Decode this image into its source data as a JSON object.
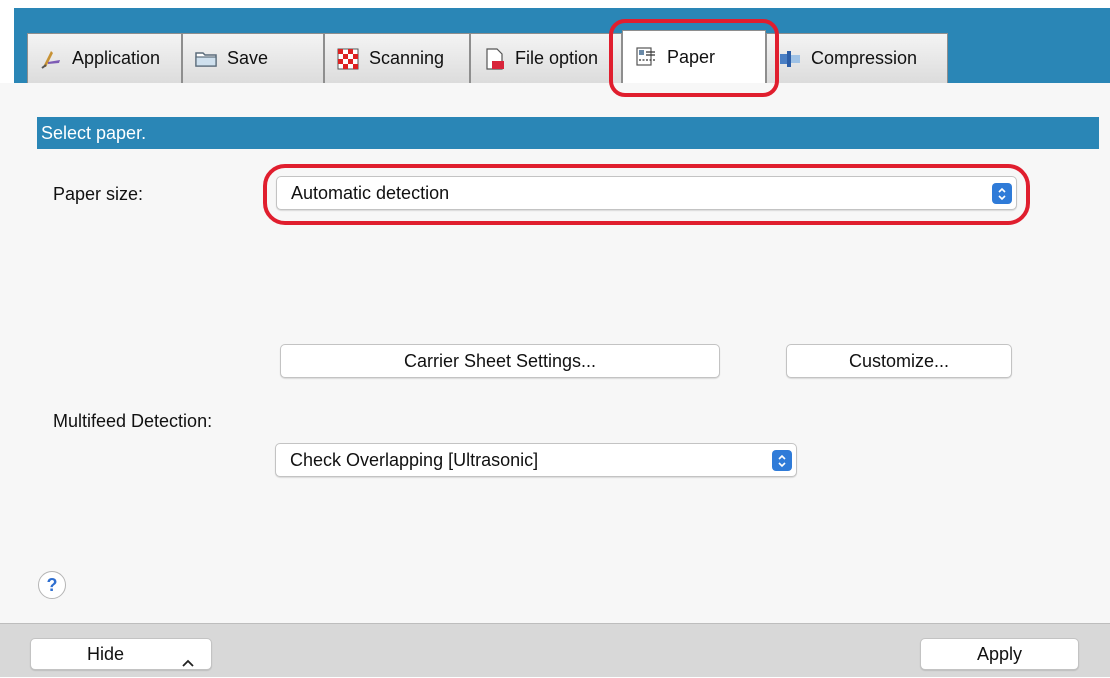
{
  "tabs": [
    {
      "label": "Application",
      "icon": "application-icon"
    },
    {
      "label": "Save",
      "icon": "folder-icon"
    },
    {
      "label": "Scanning",
      "icon": "scanning-icon"
    },
    {
      "label": "File option",
      "icon": "file-option-icon"
    },
    {
      "label": "Paper",
      "icon": "paper-icon",
      "active": true
    },
    {
      "label": "Compression",
      "icon": "compression-icon"
    }
  ],
  "section": {
    "title": "Select paper."
  },
  "paper_size": {
    "label": "Paper size:",
    "value": "Automatic detection"
  },
  "buttons": {
    "carrier": "Carrier Sheet Settings...",
    "customize": "Customize..."
  },
  "multifeed": {
    "label": "Multifeed Detection:",
    "value": "Check Overlapping [Ultrasonic]"
  },
  "help": {
    "symbol": "?"
  },
  "footer": {
    "hide": "Hide",
    "apply": "Apply"
  },
  "colors": {
    "accent": "#2a86b6",
    "highlight": "#e01e2e",
    "stepper": "#2f7bd8"
  }
}
